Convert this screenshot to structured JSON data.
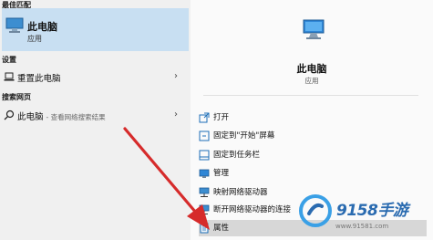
{
  "left": {
    "best_match_header": "最佳匹配",
    "best_match": {
      "title": "此电脑",
      "subtitle": "应用"
    },
    "settings_header": "设置",
    "settings_item": {
      "label": "重置此电脑"
    },
    "web_header": "搜索网页",
    "web_item": {
      "label": "此电脑",
      "hint": "- 查看网络搜索结果"
    }
  },
  "right": {
    "title": "此电脑",
    "subtitle": "应用",
    "menu": [
      {
        "label": "打开",
        "icon": "open-icon"
      },
      {
        "label": "固定到\"开始\"屏幕",
        "icon": "pin-start-icon"
      },
      {
        "label": "固定到任务栏",
        "icon": "pin-taskbar-icon"
      },
      {
        "label": "管理",
        "icon": "manage-icon"
      },
      {
        "label": "映射网络驱动器",
        "icon": "map-drive-icon"
      },
      {
        "label": "断开网络驱动器的连接",
        "icon": "disconnect-drive-icon"
      },
      {
        "label": "属性",
        "icon": "properties-icon"
      }
    ]
  },
  "watermark": {
    "brand": "9158手游",
    "url": "www.91581.com"
  },
  "colors": {
    "selected_bg": "#c8dff2",
    "accent": "#2a6bb0",
    "arrow": "#d62b2b"
  }
}
